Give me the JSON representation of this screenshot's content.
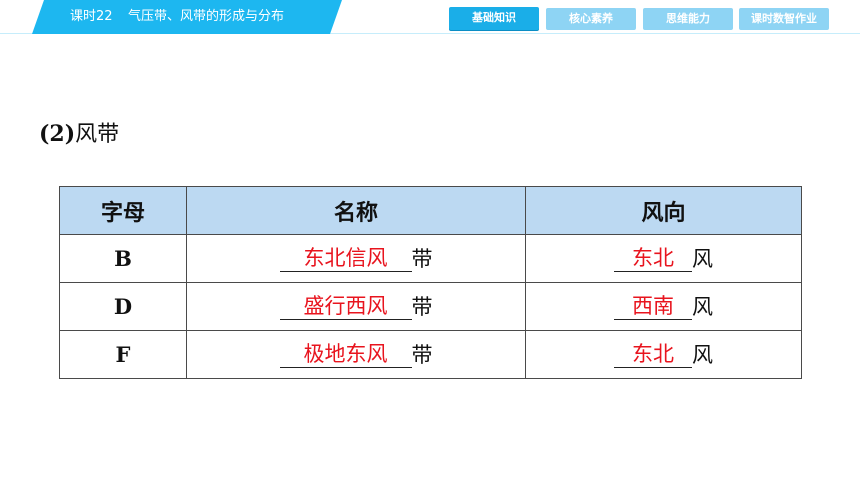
{
  "header": {
    "lesson_no": "课时22",
    "lesson_title": "气压带、风带的形成与分布",
    "nav": [
      {
        "label": "基础知识",
        "active": true
      },
      {
        "label": "核心素养",
        "active": false
      },
      {
        "label": "思维能力",
        "active": false
      },
      {
        "label": "课时数智作业",
        "active": false
      }
    ]
  },
  "colors": {
    "accent": "#1db7f0",
    "answer": "#e8141e",
    "table_header_bg": "#bcd9f2"
  },
  "section": {
    "number": "(2)",
    "title": "风带"
  },
  "table": {
    "headers": [
      "字母",
      "名称",
      "风向"
    ],
    "rows": [
      {
        "letter": "B",
        "name_answer": "东北信风",
        "name_suffix": "带",
        "dir_answer": "东北",
        "dir_suffix": "风"
      },
      {
        "letter": "D",
        "name_answer": "盛行西风",
        "name_suffix": "带",
        "dir_answer": "西南",
        "dir_suffix": "风"
      },
      {
        "letter": "F",
        "name_answer": "极地东风",
        "name_suffix": "带",
        "dir_answer": "东北",
        "dir_suffix": "风"
      }
    ]
  }
}
